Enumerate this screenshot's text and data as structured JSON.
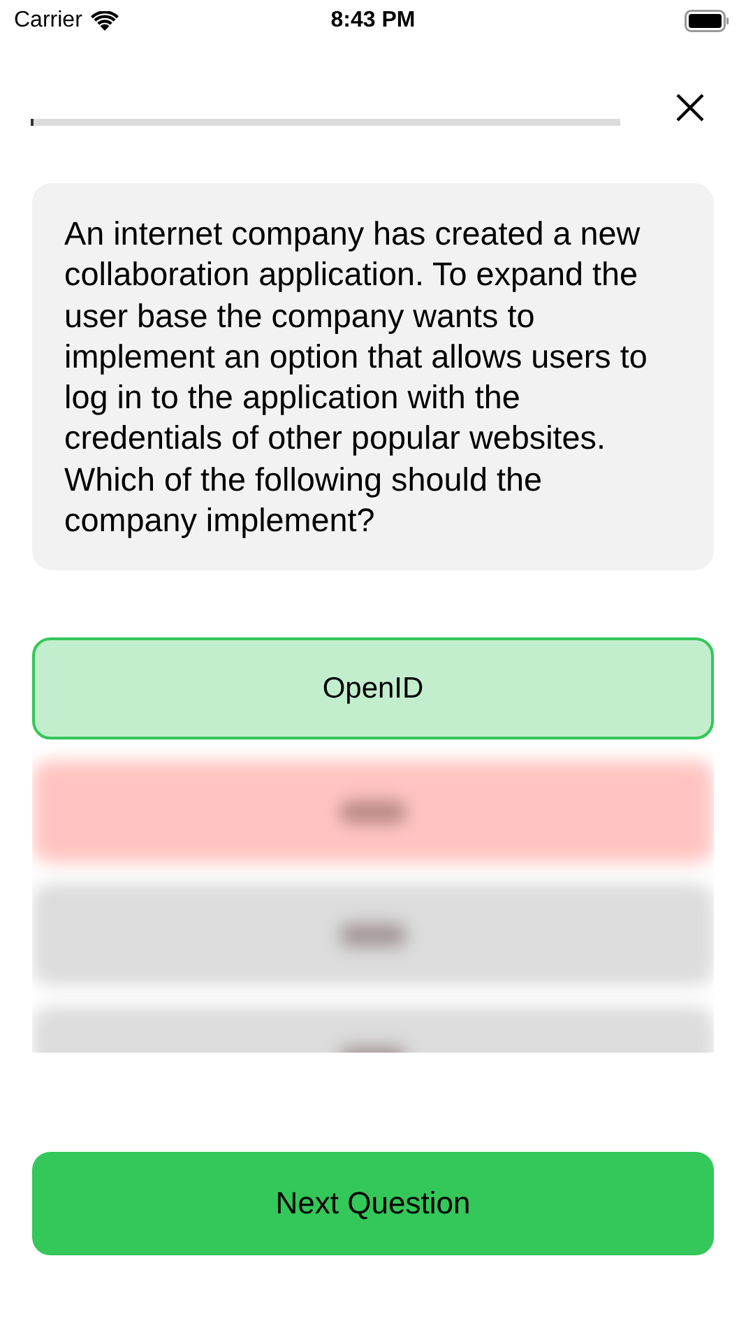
{
  "status_bar": {
    "carrier": "Carrier",
    "time": "8:43 PM"
  },
  "progress": {
    "level": 0.005
  },
  "question": "An internet company has created a new collaboration application. To expand the user base the company wants to implement an option that allows users to log in to the application with the credentials of other popular websites. Which of the following should the company implement?",
  "options": [
    {
      "kind": "clear",
      "correct": true,
      "wrong": false,
      "label": "OpenID"
    },
    {
      "kind": "blurred",
      "correct": false,
      "wrong": true
    },
    {
      "kind": "blurred",
      "correct": false,
      "wrong": false
    },
    {
      "kind": "blurred",
      "correct": false,
      "wrong": false
    }
  ],
  "next_button": "Next Question"
}
